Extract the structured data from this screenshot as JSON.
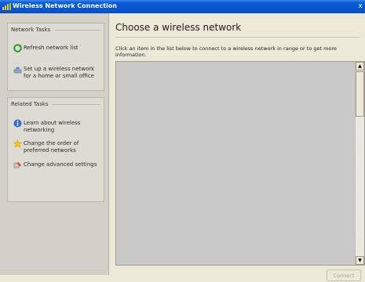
{
  "window": {
    "title": "Wireless Network Connection",
    "close_glyph": "x"
  },
  "sidebar": {
    "network_tasks": {
      "title": "Network Tasks",
      "items": [
        {
          "label": "Refresh network list",
          "icon": "refresh-icon"
        },
        {
          "label": "Set up a wireless network for a home or small office",
          "icon": "setup-wireless-icon"
        }
      ]
    },
    "related_tasks": {
      "title": "Related Tasks",
      "items": [
        {
          "label": "Learn about wireless networking",
          "icon": "info-icon"
        },
        {
          "label": "Change the order of preferred networks",
          "icon": "star-icon"
        },
        {
          "label": "Change advanced settings",
          "icon": "settings-icon"
        }
      ]
    }
  },
  "main": {
    "heading": "Choose a wireless network",
    "instructions": "Click an item in the list below to connect to a wireless network in range or to get more information.",
    "connect_label": "Connect"
  },
  "colors": {
    "titlebar_blue": "#0654cf",
    "listbox_bg": "#c9c9c9",
    "sidebar_bg": "#d4d0c8"
  }
}
